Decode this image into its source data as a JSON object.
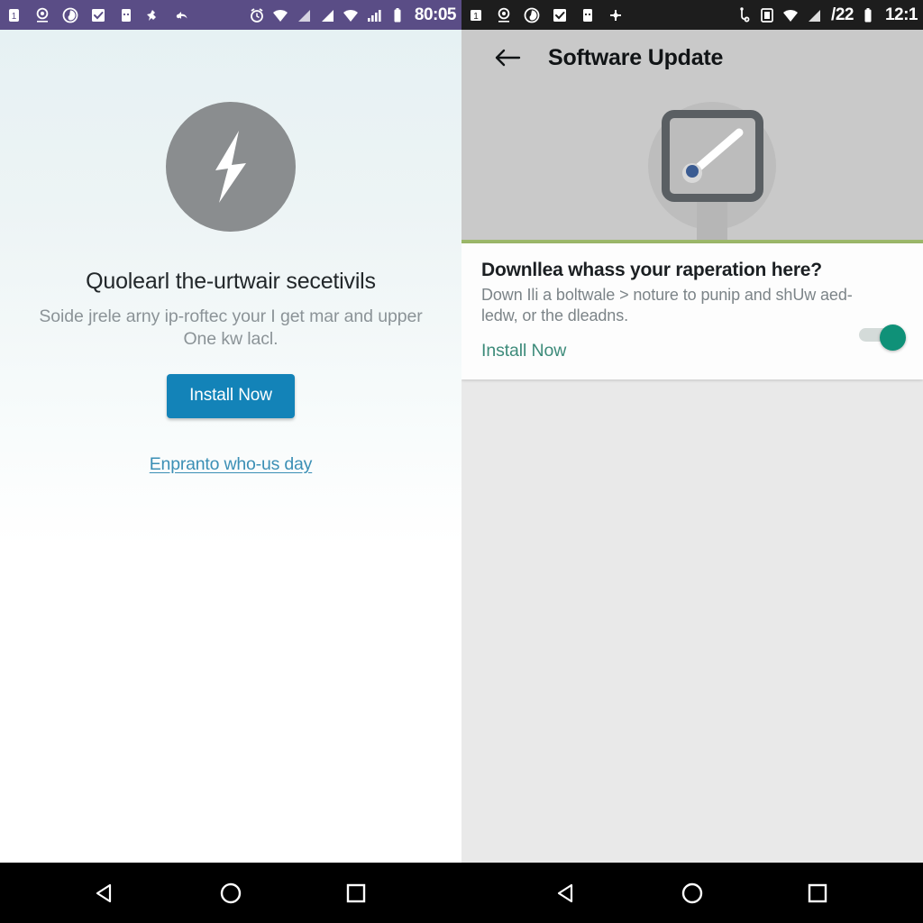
{
  "left_phone": {
    "status_bar": {
      "background_color": "#5a4d86",
      "time": "80:05",
      "left_icons": [
        "sim-icon",
        "location-icon",
        "chat-icon",
        "checkbox-icon",
        "message-icon",
        "plugin-icon",
        "share-icon"
      ],
      "right_icons": [
        "alarm-icon",
        "wifi-icon",
        "signal-icon",
        "signal-icon-2",
        "wifi-alt-icon",
        "cellular-bars-icon",
        "battery-icon"
      ]
    },
    "hero_icon": "lightning-bolt-icon",
    "title": "Quolearl the-urtwair secetivils",
    "subtitle": "Soide jrele arny ip-roftec your I get mar and upper One kw lacl.",
    "primary_button": "Install Now",
    "primary_button_color": "#1383b8",
    "link": "Enpranto who-us day",
    "link_color": "#3b8fb5",
    "nav": [
      "back-triangle-icon",
      "home-circle-icon",
      "recents-square-icon"
    ]
  },
  "right_phone": {
    "status_bar": {
      "background_color": "#1d1d1d",
      "time": "12:1",
      "badge": "/22",
      "left_icons": [
        "sim-icon",
        "location-icon",
        "chat-icon",
        "checkbox-icon",
        "message-icon",
        "share-icon"
      ],
      "right_icons": [
        "usb-icon",
        "sim-card-icon",
        "wifi-icon",
        "signal-icon",
        "battery-icon"
      ]
    },
    "app_bar": {
      "back_icon": "arrow-left-icon",
      "title": "Software Update",
      "background_color": "#c9c9c9"
    },
    "hero": {
      "illustration": "device-with-needle-icon",
      "divider_color": "#9cb86a"
    },
    "card": {
      "title": "Downllea whass your raperation here?",
      "body": "Down Ili a boltwale > noture to punip and shUw aed-ledw, or the dleadns.",
      "link": "Install Now",
      "link_color": "#3d8b7a",
      "toggle_state": "on",
      "toggle_color": "#0f9178"
    },
    "nav": [
      "back-triangle-icon",
      "home-circle-icon",
      "recents-square-icon"
    ]
  }
}
